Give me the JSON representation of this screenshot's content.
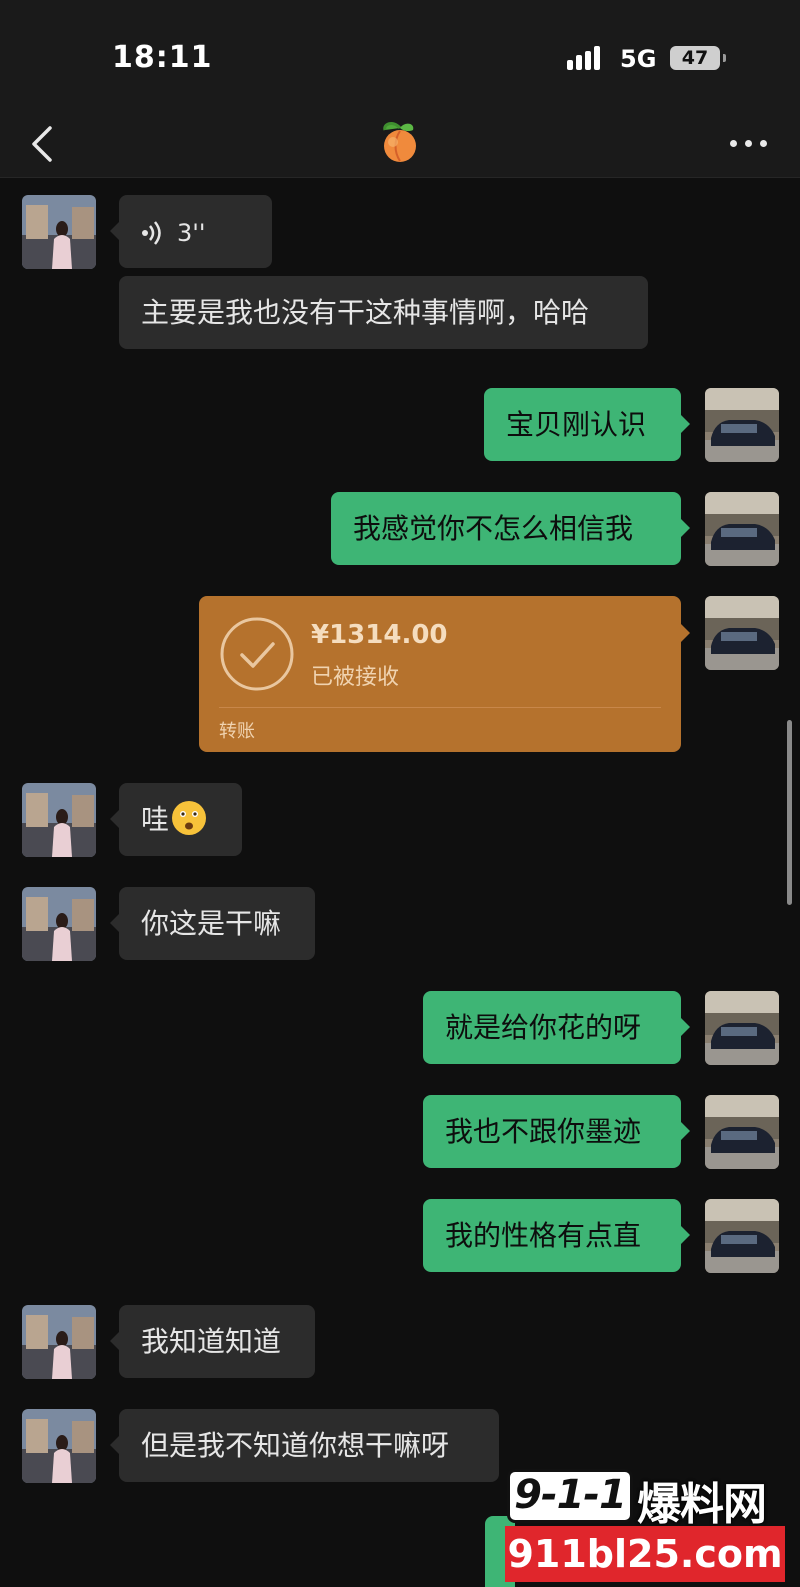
{
  "status_bar": {
    "time": "18:11",
    "network": "5G",
    "battery": "47"
  },
  "nav": {
    "title_icon": "peach-emoji"
  },
  "messages": [
    {
      "side": "in",
      "type": "voice",
      "duration": "3''"
    },
    {
      "side": "in",
      "type": "text",
      "text": "主要是我也没有干这种事情啊，哈哈"
    },
    {
      "side": "out",
      "type": "text",
      "text": "宝贝刚认识"
    },
    {
      "side": "out",
      "type": "text",
      "text": "我感觉你不怎么相信我"
    },
    {
      "side": "out",
      "type": "transfer",
      "amount": "¥1314.00",
      "status": "已被接收",
      "label": "转账"
    },
    {
      "side": "in",
      "type": "text",
      "text": "哇",
      "emoji": "astonished-face-emoji"
    },
    {
      "side": "in",
      "type": "text",
      "text": "你这是干嘛"
    },
    {
      "side": "out",
      "type": "text",
      "text": "就是给你花的呀"
    },
    {
      "side": "out",
      "type": "text",
      "text": "我也不跟你墨迹"
    },
    {
      "side": "out",
      "type": "text",
      "text": "我的性格有点直"
    },
    {
      "side": "in",
      "type": "text",
      "text": "我知道知道"
    },
    {
      "side": "in",
      "type": "text",
      "text": "但是我不知道你想干嘛呀"
    }
  ],
  "watermark": {
    "number": "9-1-1",
    "name": "爆料网",
    "url": "911bl25.com"
  },
  "colors": {
    "outgoing_bubble": "#3eb575",
    "incoming_bubble": "#2c2c2c",
    "transfer_card": "#b5722d",
    "background": "#0f0f0f",
    "watermark_red": "#e0262c"
  }
}
